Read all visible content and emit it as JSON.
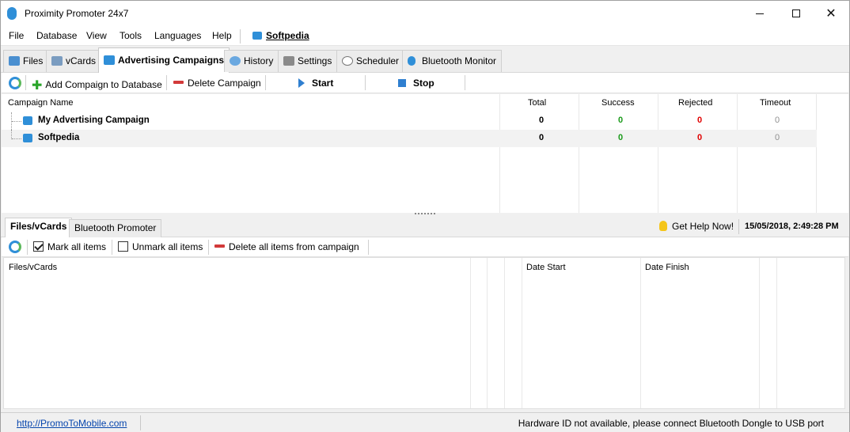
{
  "window": {
    "title": "Proximity Promoter 24x7"
  },
  "menu": {
    "items": [
      "File",
      "Database",
      "View",
      "Tools",
      "Languages",
      "Help"
    ],
    "link_label": "Softpedia"
  },
  "tabs": [
    "Files",
    "vCards",
    "Advertising Campaigns",
    "History",
    "Settings",
    "Scheduler",
    "Bluetooth Monitor"
  ],
  "toolbar": {
    "add": "Add Compaign to Database",
    "delete": "Delete Campaign",
    "start": "Start",
    "stop": "Stop"
  },
  "campaigns": {
    "columns": [
      "Campaign Name",
      "Total",
      "Success",
      "Rejected",
      "Timeout"
    ],
    "rows": [
      {
        "name": "My Advertising Campaign",
        "total": "0",
        "success": "0",
        "rejected": "0",
        "timeout": "0"
      },
      {
        "name": "Softpedia",
        "total": "0",
        "success": "0",
        "rejected": "0",
        "timeout": "0"
      }
    ]
  },
  "lower_tabs": [
    "Files/vCards",
    "Bluetooth Promoter"
  ],
  "help": {
    "label": "Get Help Now!",
    "datetime": "15/05/2018, 2:49:28 PM"
  },
  "toolbar2": {
    "mark_all": "Mark all items",
    "unmark_all": "Unmark all items",
    "delete_all": "Delete all items from campaign"
  },
  "files": {
    "columns": [
      "Files/vCards",
      "Date Start",
      "Date Finish"
    ]
  },
  "status": {
    "link": "http://PromoToMobile.com",
    "message": "Hardware ID not available, please connect Bluetooth Dongle to USB port"
  },
  "colors": {
    "accent": "#2f8fd8",
    "success": "#1a9a1a",
    "rejected": "#e00000",
    "timeout": "#909090"
  }
}
